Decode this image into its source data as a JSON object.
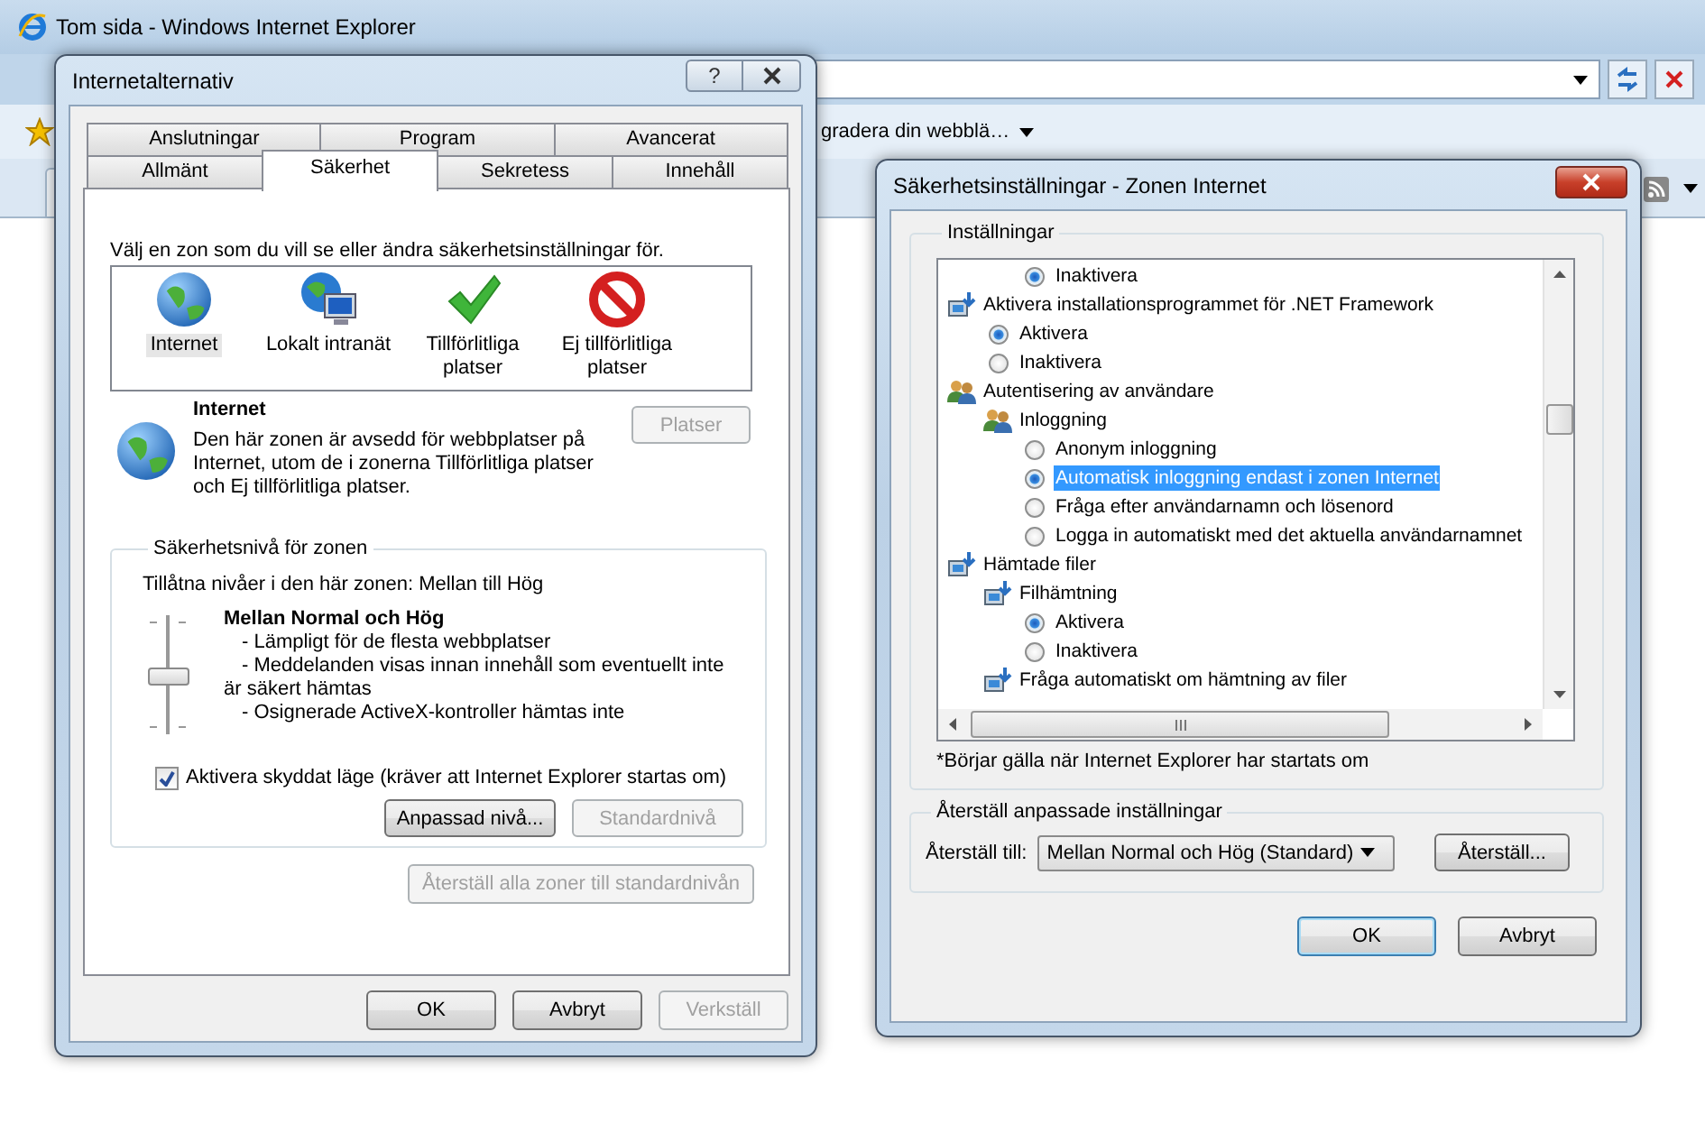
{
  "browser": {
    "title": "Tom sida - Windows Internet Explorer",
    "favorites_link": "gradera din webblä…"
  },
  "internet_options": {
    "title": "Internetalternativ",
    "help_button": "?",
    "tab_rows": [
      [
        {
          "label": "Anslutningar",
          "selected": false
        },
        {
          "label": "Program",
          "selected": false
        },
        {
          "label": "Avancerat",
          "selected": false
        }
      ],
      [
        {
          "label": "Allmänt",
          "selected": false
        },
        {
          "label": "Säkerhet",
          "selected": true
        },
        {
          "label": "Sekretess",
          "selected": false
        },
        {
          "label": "Innehåll",
          "selected": false
        }
      ]
    ],
    "zone_prompt": "Välj en zon som du vill se eller ändra säkerhetsinställningar för.",
    "zones": [
      {
        "label": "Internet",
        "kind": "internet",
        "selected": true
      },
      {
        "label": "Lokalt intranät",
        "kind": "intranet",
        "selected": false
      },
      {
        "label": "Tillförlitliga platser",
        "kind": "trusted",
        "selected": false
      },
      {
        "label": "Ej tillförlitliga platser",
        "kind": "restricted",
        "selected": false
      }
    ],
    "zone_info": {
      "name": "Internet",
      "description": "Den här zonen är avsedd för webbplatser på Internet, utom de i zonerna Tillförlitliga platser och Ej tillförlitliga platser.",
      "button": {
        "label": "Platser",
        "disabled": true
      }
    },
    "security_level": {
      "legend": "Säkerhetsnivå för zonen",
      "allowed": "Tillåtna nivåer i den här zonen: Mellan till Hög",
      "level": 0.5,
      "level_name": "Mellan Normal och Hög",
      "bullets": [
        "- Lämpligt för de flesta webbplatser",
        "- Meddelanden visas innan innehåll som eventuellt inte är säkert hämtas",
        "- Osignerade ActiveX-kontroller hämtas inte"
      ],
      "protected_mode": {
        "label": "Aktivera skyddat läge (kräver att Internet Explorer startas om)",
        "checked": true
      },
      "buttons": [
        {
          "label": "Anpassad nivå...",
          "disabled": false
        },
        {
          "label": "Standardnivå",
          "disabled": true
        }
      ]
    },
    "reset_all": {
      "label": "Återställ alla zoner till standardnivån",
      "disabled": true
    },
    "buttons": [
      {
        "label": "OK",
        "disabled": false
      },
      {
        "label": "Avbryt",
        "disabled": false
      },
      {
        "label": "Verkställ",
        "disabled": true
      }
    ]
  },
  "security_settings": {
    "title": "Säkerhetsinställningar - Zonen Internet",
    "settings_legend": "Inställningar",
    "tree": [
      {
        "kind": "group",
        "children": [
          {
            "kind": "group",
            "children": [
              {
                "kind": "radio",
                "label": "Inaktivera",
                "selected": true,
                "focused": false
              }
            ]
          }
        ]
      },
      {
        "kind": "computer",
        "label": "Aktivera installationsprogrammet för .NET Framework",
        "children": [
          {
            "kind": "radio",
            "label": "Aktivera",
            "selected": true,
            "focused": false
          },
          {
            "kind": "radio",
            "label": "Inaktivera",
            "selected": false,
            "focused": false
          }
        ]
      },
      {
        "kind": "users",
        "label": "Autentisering av användare",
        "children": [
          {
            "kind": "users",
            "label": "Inloggning",
            "children": [
              {
                "kind": "radio",
                "label": "Anonym inloggning",
                "selected": false,
                "focused": false
              },
              {
                "kind": "radio",
                "label": "Automatisk inloggning endast i zonen Internet",
                "selected": true,
                "focused": true
              },
              {
                "kind": "radio",
                "label": "Fråga efter användarnamn och lösenord",
                "selected": false,
                "focused": false
              },
              {
                "kind": "radio",
                "label": "Logga in automatiskt med det aktuella användarnamnet",
                "selected": false,
                "focused": false
              }
            ]
          }
        ]
      },
      {
        "kind": "computer",
        "label": "Hämtade filer",
        "children": [
          {
            "kind": "computer",
            "label": "Filhämtning",
            "children": [
              {
                "kind": "radio",
                "label": "Aktivera",
                "selected": true,
                "focused": false
              },
              {
                "kind": "radio",
                "label": "Inaktivera",
                "selected": false,
                "focused": false
              }
            ]
          },
          {
            "kind": "computer",
            "label": "Fråga automatiskt om hämtning av filer"
          }
        ]
      }
    ],
    "note": "*Börjar gälla när Internet Explorer har startats om",
    "reset_group": {
      "legend": "Återställ anpassade inställningar",
      "label": "Återställ till:",
      "value": "Mellan Normal och Hög (Standard)",
      "button": "Återställ..."
    },
    "buttons": [
      {
        "label": "OK",
        "default": true
      },
      {
        "label": "Avbryt",
        "default": false
      }
    ]
  }
}
